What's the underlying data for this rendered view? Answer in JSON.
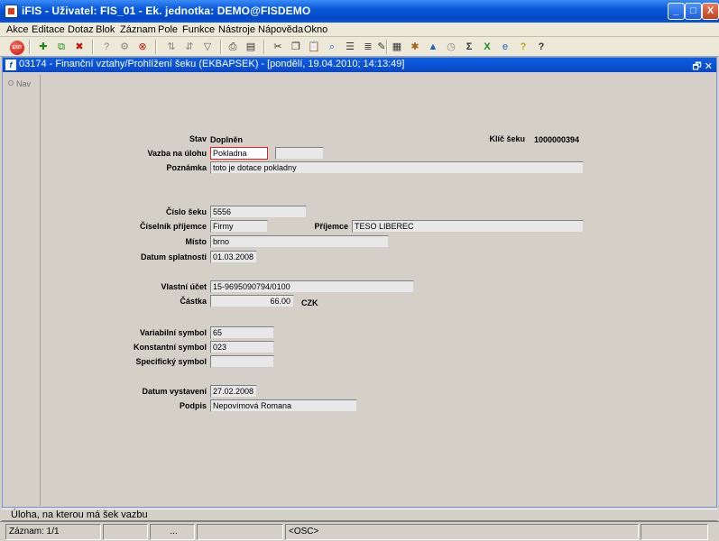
{
  "window": {
    "title": "iFIS - Uživatel: FIS_01 - Ek. jednotka: DEMO@FISDEMO",
    "controls": {
      "minimize": "_",
      "maximize": "□",
      "close": "X"
    }
  },
  "menubar": {
    "items": [
      "Akce",
      "Editace",
      "Dotaz",
      "Blok",
      "Záznam",
      "Pole",
      "Funkce",
      "Nástroje",
      "Nápověda",
      "Okno"
    ]
  },
  "toolbar": {
    "exit_label": "EXIT"
  },
  "form_window": {
    "title": "03174 - Finanční vztahy/Prohlížení šeku (EKBAPSEK) - [pondělí, 19.04.2010; 14:13:49]",
    "doc_icon": "f",
    "controls": "🗗 ✕",
    "nav_label": "Nav"
  },
  "form": {
    "stav_label": "Stav",
    "stav_value": "Doplněn",
    "klic_label": "Klíč šeku",
    "klic_value": "1000000394",
    "vazba_label": "Vazba na úlohu",
    "vazba_value": "Pokladna",
    "vazba_extra": "",
    "poznamka_label": "Poznámka",
    "poznamka_value": "toto je dotace pokladny",
    "cislo_label": "Číslo šeku",
    "cislo_value": "5556",
    "ciselnik_label": "Číselník příjemce",
    "ciselnik_value": "Firmy",
    "prijemce_label": "Příjemce",
    "prijemce_value": "TESO LIBEREC",
    "misto_label": "Místo",
    "misto_value": "brno",
    "splatnost_label": "Datum splatnosti",
    "splatnost_value": "01.03.2008",
    "ucet_label": "Vlastní účet",
    "ucet_value": "15-9695090794/0100",
    "castka_label": "Částka",
    "castka_value": "66.00",
    "mena_value": "CZK",
    "vs_label": "Variabilní symbol",
    "vs_value": "65",
    "ks_label": "Konstantní symbol",
    "ks_value": "023",
    "ss_label": "Specifický symbol",
    "ss_value": "",
    "vystaveni_label": "Datum vystavení",
    "vystaveni_value": "27.02.2008",
    "podpis_label": "Podpis",
    "podpis_value": "Nepovímová Romana"
  },
  "status": {
    "hint": "Úloha, na kterou má šek vazbu",
    "record": "Záznam: 1/1",
    "ellipsis": "...",
    "mode": "<OSC>"
  }
}
